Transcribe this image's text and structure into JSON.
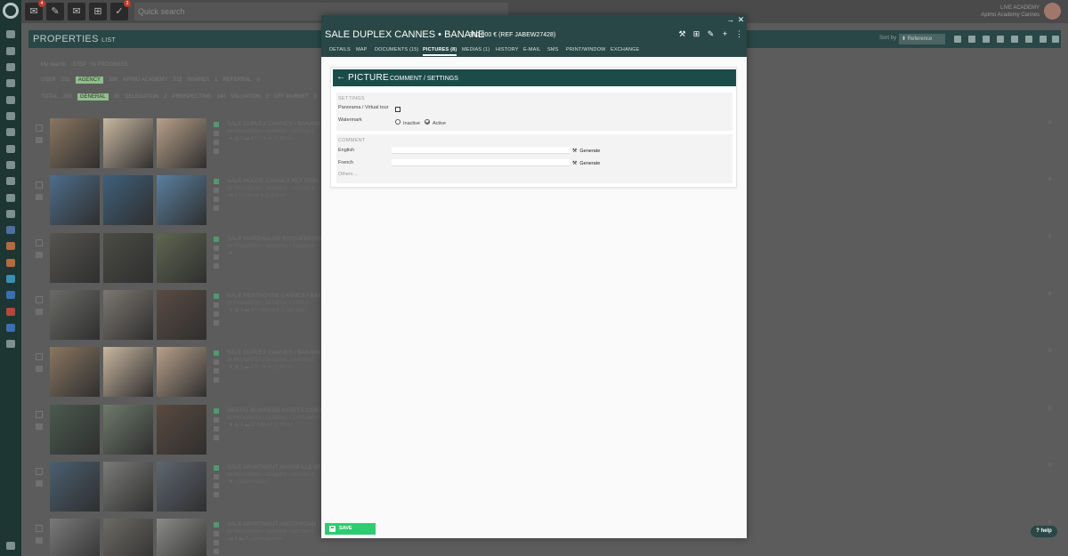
{
  "app": {
    "quick_search_placeholder": "Quick search",
    "user_name": "Apimo Academy Cannes",
    "user_line": "LIVE ACADEMY",
    "badges": {
      "notifications": "4",
      "likes": "2"
    }
  },
  "properties": {
    "title": "PROPERTIES",
    "title_suffix": "LIST",
    "sort_label": "Sort by",
    "sort_value": "Reference",
    "my_search": "My search",
    "my_search_values": "STEP : IN PROGRESS",
    "filter_row1": [
      {
        "label": "USER",
        "count": "231"
      },
      {
        "label": "AGENCY",
        "count": "386",
        "highlight": true
      },
      {
        "label": "APIMO ACADEMY",
        "count": "515"
      },
      {
        "label": "SHARES",
        "count": "1"
      },
      {
        "label": "REFERRAL",
        "count": "0"
      }
    ],
    "filter_row2": [
      {
        "label": "TOTAL",
        "count": "386"
      },
      {
        "label": "GENERAL",
        "count": "39",
        "highlight": true
      },
      {
        "label": "DELEGATION",
        "count": "2"
      },
      {
        "label": "PROSPECTING",
        "count": "240"
      },
      {
        "label": "VALUATION",
        "count": "2"
      },
      {
        "label": "OFF MARKET",
        "count": "3"
      }
    ],
    "rows": [
      {
        "title": "SALE DUPLEX CANNES • BANANE JA",
        "sub": "IN PROGRESS / GENERAL / 300,000 €",
        "feat": "★  ▤ 3  ▬ 3  ⤧ 74 m²  ◫ 50 m²",
        "like": "0",
        "thumbs": [
          "#8a7660",
          "#c9b7a0",
          "#b7a08a"
        ]
      },
      {
        "title": "SALE HOUSE CANNES REF 025H",
        "sub": "IN PROGRESS / GENERAL / 700,000 €",
        "feat": "▤ 5  ⤧ 190 m²  ♥  ◫ 800 m²",
        "like": "0",
        "thumbs": [
          "#4d6d8a",
          "#3f5f7a",
          "#5a7f9f"
        ]
      },
      {
        "title": "SALE WAREHOUSE ROQUEBRUNE-SU",
        "sub": "IN PROGRESS / GENERAL / 700,000 €",
        "feat": "★",
        "like": "0",
        "thumbs": [
          "#55544f",
          "#4b4c45",
          "#5f6650"
        ]
      },
      {
        "title": "SALE PENTHOUSE CANNES • BANAN",
        "sub": "IN PROGRESS / GENERAL / 2,500 €",
        "feat": "★  ▤ 3  ▬ 3  ⤧ 150 sq.ft  ◫ 110 sq.ft",
        "like": "0",
        "thumbs": [
          "#6a6a66",
          "#7c7771",
          "#5a4b42"
        ]
      },
      {
        "title": "SALE DUPLEX CANNES • BANANE (7",
        "sub": "IN PROGRESS / GENERAL / 300,000 €",
        "feat": "★  ▤ 3  ▬ 3  ⤧ 74 m²  ◫ 50 m²",
        "like": "0",
        "thumbs": [
          "#8a7660",
          "#c9b7a0",
          "#b7a08a"
        ]
      },
      {
        "title": "RENTAL BUSINESS ASSETS CONTES",
        "sub": "IN PROGRESS / GENERAL / 1,000,000 € R",
        "feat": "★  ▤ 4  ▬ 3  ⤧ 85 m²  ◫ 50 m²",
        "like": "0",
        "thumbs": [
          "#4a5a4e",
          "#6d7a6a",
          "#5a4a3f"
        ]
      },
      {
        "title": "SALE APARTMENT MARSEILLE 6EME",
        "sub": "IN PROGRESS / GENERAL / 265,000 €",
        "feat": "★  ⌂ Unobstructed",
        "like": "0",
        "thumbs": [
          "#4a5f70",
          "#7a7a78",
          "#5e6670"
        ]
      },
      {
        "title": "SALE APARTMENT AMSTERDAM - MA",
        "sub": "IN PROGRESS / GENERAL / 207,000 €",
        "feat": "▤ 5  ▬ 3  ⌂ Unobstructed",
        "like": "0",
        "thumbs": [
          "#7a7a7a",
          "#6c6a64",
          "#8a8a88"
        ]
      }
    ]
  },
  "modal": {
    "title": "SALE DUPLEX CANNES • BANANE",
    "price_ref": "300,000 € (REF JABEW27428)",
    "tabs": [
      {
        "label": "DETAILS"
      },
      {
        "label": "MAP"
      },
      {
        "label": "DOCUMENTS (15)"
      },
      {
        "label": "PICTURES (8)",
        "active": true
      },
      {
        "label": "MEDIAS (1)"
      },
      {
        "label": "HISTORY"
      },
      {
        "label": "E-MAIL"
      },
      {
        "label": "SMS"
      },
      {
        "label": "PRINT/WINDOW"
      },
      {
        "label": "EXCHANGE"
      }
    ],
    "panel": {
      "title": "PICTURE",
      "subtitle": "COMMENT / SETTINGS",
      "settings_label": "SETTINGS",
      "panorama_label": "Panorama / Virtual tour",
      "watermark_label": "Watermark",
      "watermark_options": [
        "Inactive",
        "Active"
      ],
      "watermark_selected": "Active",
      "comment_label": "COMMENT",
      "english_label": "English",
      "french_label": "French",
      "generate_label": "Generate",
      "others_label": "Others ...",
      "english_value": "",
      "french_value": ""
    },
    "save_label": "SAVE"
  },
  "help_label": "help",
  "icons": {
    "wand": "magic-wand-icon",
    "cart": "cart-icon",
    "edit": "pencil-icon",
    "add": "plus-icon",
    "more": "more-vertical-icon",
    "arrow": "arrow-right-icon",
    "close": "close-icon"
  }
}
